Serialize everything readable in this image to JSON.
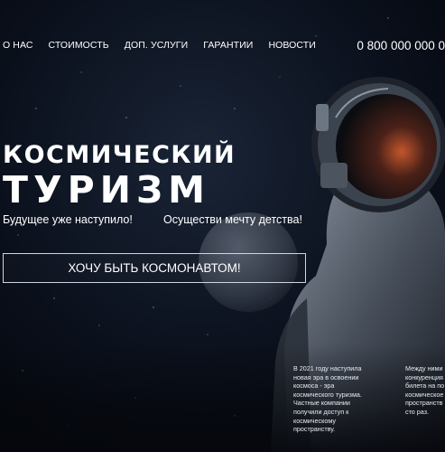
{
  "nav": {
    "items": [
      "О НАС",
      "СТОИМОСТЬ",
      "ДОП. УСЛУГИ",
      "ГАРАНТИИ",
      "НОВОСТИ"
    ],
    "phone": "0 800 000 000 0"
  },
  "hero": {
    "title_line1": "КОСМИЧЕСКИЙ",
    "title_line2": "ТУРИЗМ",
    "tagline_left": "Будущее уже наступило!",
    "tagline_right": "Осуществи мечту детства!",
    "cta_label": "ХОЧУ БЫТЬ КОСМОНАВТОМ!"
  },
  "info": {
    "block1": [
      "В 2021 году наступила",
      "новая эра в освоении",
      "космоса - эра",
      "космического туризма.",
      "Частные компании",
      "получили доступ к",
      "космическому",
      "пространству."
    ],
    "block2": [
      "Между ними",
      "конкуренция",
      "билета на по",
      "космическое",
      "пространств",
      "сто раз."
    ]
  },
  "colors": {
    "background": "#05070c",
    "text": "#ffffff",
    "button_border": "#cfd6e0"
  },
  "icons": {
    "background": "space-astronaut-image"
  }
}
